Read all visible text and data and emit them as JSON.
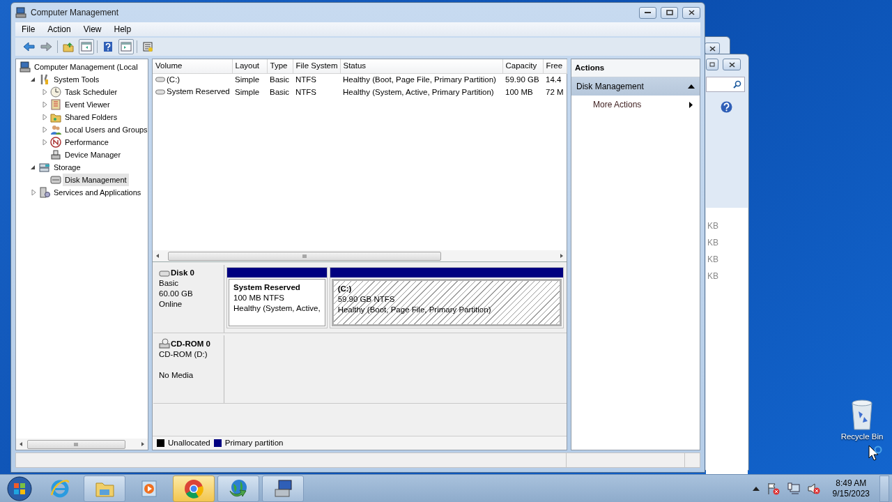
{
  "background_windows": {
    "size_fragments": [
      "KB",
      "KB",
      "KB",
      "KB"
    ]
  },
  "window": {
    "title": "Computer Management",
    "menu": [
      "File",
      "Action",
      "View",
      "Help"
    ],
    "tree": [
      {
        "label": "Computer Management (Local",
        "kind": "computer",
        "selected": false,
        "children": [
          {
            "label": "System Tools",
            "kind": "tools",
            "expanded": true,
            "selected": false,
            "children": [
              {
                "label": "Task Scheduler",
                "kind": "clock",
                "expanded": false,
                "selected": false
              },
              {
                "label": "Event Viewer",
                "kind": "log",
                "expanded": false,
                "selected": false
              },
              {
                "label": "Shared Folders",
                "kind": "folder",
                "expanded": false,
                "selected": false
              },
              {
                "label": "Local Users and Groups",
                "kind": "users",
                "expanded": false,
                "selected": false
              },
              {
                "label": "Performance",
                "kind": "gauge",
                "expanded": false,
                "selected": false
              },
              {
                "label": "Device Manager",
                "kind": "device",
                "selected": false
              }
            ]
          },
          {
            "label": "Storage",
            "kind": "storage",
            "expanded": true,
            "selected": false,
            "children": [
              {
                "label": "Disk Management",
                "kind": "disk",
                "selected": true
              }
            ]
          },
          {
            "label": "Services and Applications",
            "kind": "services",
            "expanded": false,
            "selected": false
          }
        ]
      }
    ],
    "volume_table": {
      "columns": [
        "Volume",
        "Layout",
        "Type",
        "File System",
        "Status",
        "Capacity",
        "Free"
      ],
      "rows": [
        [
          "(C:)",
          "Simple",
          "Basic",
          "NTFS",
          "Healthy (Boot, Page File, Primary Partition)",
          "59.90 GB",
          "14.4"
        ],
        [
          "System Reserved",
          "Simple",
          "Basic",
          "NTFS",
          "Healthy (System, Active, Primary Partition)",
          "100 MB",
          "72 M"
        ]
      ]
    },
    "disks": [
      {
        "name": "Disk 0",
        "kind": "disk",
        "type": "Basic",
        "size": "60.00 GB",
        "status": "Online",
        "partitions": [
          {
            "name": "System Reserved",
            "size": "100 MB NTFS",
            "status": "Healthy (System, Active,",
            "selected": false
          },
          {
            "name": "(C:)",
            "size": "59.90 GB NTFS",
            "status": "Healthy (Boot, Page File, Primary Partition)",
            "selected": true
          }
        ]
      },
      {
        "name": "CD-ROM 0",
        "kind": "cdrom",
        "type": "CD-ROM (D:)",
        "status": "No Media"
      }
    ],
    "legend": [
      {
        "label": "Unallocated",
        "color": "#000000",
        "kind": "unallocated"
      },
      {
        "label": "Primary partition",
        "color": "#000080",
        "kind": "primary"
      }
    ],
    "actions": {
      "title": "Actions",
      "section": "Disk Management",
      "expanded": true,
      "items": [
        "More Actions"
      ]
    }
  },
  "desktop": {
    "icons": [
      "Recycle Bin"
    ]
  },
  "taskbar": {
    "apps": [
      {
        "kind": "ie",
        "running": false,
        "selected": false
      },
      {
        "kind": "folder",
        "running": true,
        "selected": false
      },
      {
        "kind": "media",
        "running": false,
        "selected": false
      },
      {
        "kind": "chrome",
        "running": true,
        "selected": true
      },
      {
        "kind": "globe",
        "running": true,
        "selected": false
      },
      {
        "kind": "computer",
        "running": true,
        "selected": false
      }
    ],
    "time": "8:49 AM",
    "date": "9/15/2023"
  }
}
